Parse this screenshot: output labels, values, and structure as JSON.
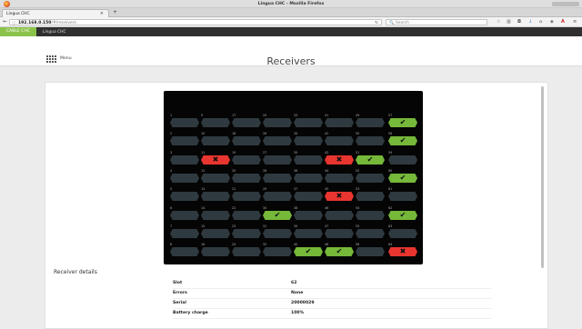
{
  "window": {
    "title": "Lingua CHC - Mozilla Firefox"
  },
  "tab": {
    "title": "Lingua CHC"
  },
  "address": {
    "host": "192.168.0.150",
    "path": "/#/receivers"
  },
  "search": {
    "placeholder": "Search"
  },
  "app": {
    "logo_text": "CABLE CHC",
    "name": "Lingua CHC"
  },
  "header": {
    "menu_label": "Menu",
    "page_title": "Receivers"
  },
  "receiver_grid": {
    "columns": 8,
    "rows": 8,
    "slots": [
      {
        "n": 1,
        "s": "empty"
      },
      {
        "n": 9,
        "s": "empty"
      },
      {
        "n": 17,
        "s": "empty"
      },
      {
        "n": 25,
        "s": "empty"
      },
      {
        "n": 33,
        "s": "empty"
      },
      {
        "n": 41,
        "s": "empty"
      },
      {
        "n": 49,
        "s": "empty"
      },
      {
        "n": 57,
        "s": "ok"
      },
      {
        "n": 2,
        "s": "empty"
      },
      {
        "n": 10,
        "s": "empty"
      },
      {
        "n": 18,
        "s": "empty"
      },
      {
        "n": 26,
        "s": "empty"
      },
      {
        "n": 34,
        "s": "empty"
      },
      {
        "n": 42,
        "s": "empty"
      },
      {
        "n": 50,
        "s": "empty"
      },
      {
        "n": 58,
        "s": "ok"
      },
      {
        "n": 3,
        "s": "empty"
      },
      {
        "n": 11,
        "s": "err"
      },
      {
        "n": 19,
        "s": "empty"
      },
      {
        "n": 27,
        "s": "empty"
      },
      {
        "n": 35,
        "s": "empty"
      },
      {
        "n": 43,
        "s": "err"
      },
      {
        "n": 51,
        "s": "ok"
      },
      {
        "n": 59,
        "s": "empty"
      },
      {
        "n": 4,
        "s": "empty"
      },
      {
        "n": 12,
        "s": "empty"
      },
      {
        "n": 20,
        "s": "empty"
      },
      {
        "n": 28,
        "s": "empty"
      },
      {
        "n": 36,
        "s": "empty"
      },
      {
        "n": 44,
        "s": "empty"
      },
      {
        "n": 52,
        "s": "empty"
      },
      {
        "n": 60,
        "s": "ok"
      },
      {
        "n": 5,
        "s": "empty"
      },
      {
        "n": 13,
        "s": "empty"
      },
      {
        "n": 21,
        "s": "empty"
      },
      {
        "n": 29,
        "s": "empty"
      },
      {
        "n": 37,
        "s": "empty"
      },
      {
        "n": 45,
        "s": "err"
      },
      {
        "n": 53,
        "s": "empty"
      },
      {
        "n": 61,
        "s": "empty"
      },
      {
        "n": 6,
        "s": "empty"
      },
      {
        "n": 14,
        "s": "empty"
      },
      {
        "n": 22,
        "s": "empty"
      },
      {
        "n": 30,
        "s": "ok"
      },
      {
        "n": 38,
        "s": "empty"
      },
      {
        "n": 46,
        "s": "empty"
      },
      {
        "n": 54,
        "s": "empty"
      },
      {
        "n": 62,
        "s": "ok"
      },
      {
        "n": 7,
        "s": "empty"
      },
      {
        "n": 15,
        "s": "empty"
      },
      {
        "n": 23,
        "s": "empty"
      },
      {
        "n": 31,
        "s": "empty"
      },
      {
        "n": 39,
        "s": "empty"
      },
      {
        "n": 47,
        "s": "empty"
      },
      {
        "n": 55,
        "s": "empty"
      },
      {
        "n": 63,
        "s": "empty"
      },
      {
        "n": 8,
        "s": "empty"
      },
      {
        "n": 16,
        "s": "empty"
      },
      {
        "n": 24,
        "s": "empty"
      },
      {
        "n": 32,
        "s": "empty"
      },
      {
        "n": 40,
        "s": "ok"
      },
      {
        "n": 48,
        "s": "ok"
      },
      {
        "n": 56,
        "s": "empty"
      },
      {
        "n": 64,
        "s": "err"
      }
    ],
    "ok_symbol": "✔",
    "err_symbol": "✖"
  },
  "details": {
    "heading": "Receiver details",
    "rows": [
      {
        "label": "Slot",
        "value": "62"
      },
      {
        "label": "Errors",
        "value": "None"
      },
      {
        "label": "Serial",
        "value": "20000029"
      },
      {
        "label": "Battery charge",
        "value": "100%"
      }
    ]
  },
  "colors": {
    "ok": "#75b83a",
    "err": "#e8352f",
    "empty": "#2f3a40",
    "logo": "#8bc34a"
  }
}
